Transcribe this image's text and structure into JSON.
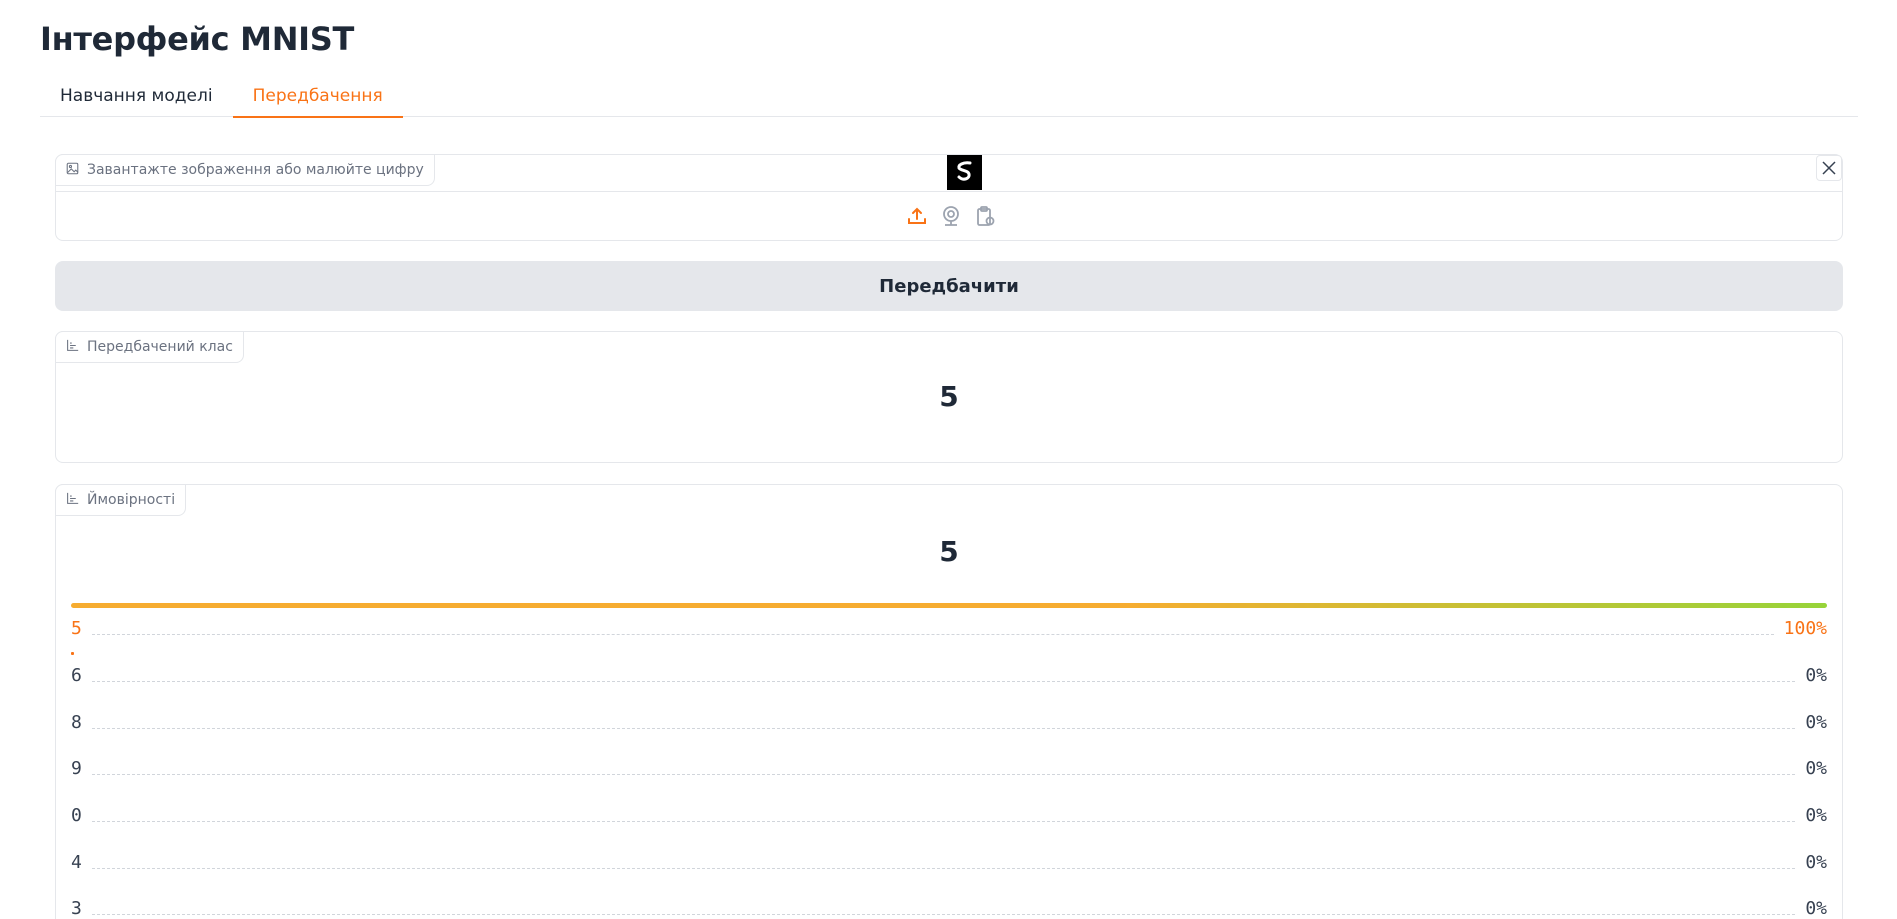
{
  "app": {
    "title": "Інтерфейс MNIST"
  },
  "tabs": [
    {
      "label": "Навчання моделі",
      "active": false
    },
    {
      "label": "Передбачення",
      "active": true
    }
  ],
  "image_input": {
    "label": "Завантажте зображення або малюйте цифру",
    "label_icon": "image-icon",
    "source_icons": [
      "upload-icon",
      "webcam-icon",
      "clipboard-icon"
    ]
  },
  "predict_button": {
    "label": "Передбачити"
  },
  "predicted_class": {
    "label": "Передбачений клас",
    "label_icon": "chart-icon",
    "value": "5"
  },
  "probabilities": {
    "label": "Ймовірності",
    "label_icon": "chart-icon",
    "top_value": "5",
    "confidences": [
      {
        "label": "5",
        "value": "100%"
      },
      {
        "label": "6",
        "value": "0%"
      },
      {
        "label": "8",
        "value": "0%"
      },
      {
        "label": "9",
        "value": "0%"
      },
      {
        "label": "0",
        "value": "0%"
      },
      {
        "label": "4",
        "value": "0%"
      },
      {
        "label": "3",
        "value": "0%"
      }
    ]
  },
  "colors": {
    "accent": "#f97316",
    "button_bg": "#e5e7eb",
    "border": "#e5e7eb"
  }
}
